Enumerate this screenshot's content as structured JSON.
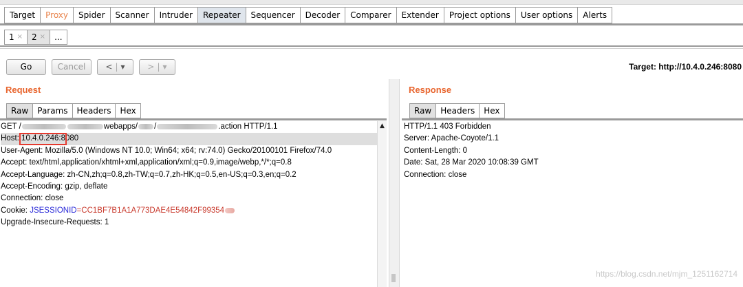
{
  "main_tabs": [
    {
      "label": "Target"
    },
    {
      "label": "Proxy"
    },
    {
      "label": "Spider"
    },
    {
      "label": "Scanner"
    },
    {
      "label": "Intruder"
    },
    {
      "label": "Repeater"
    },
    {
      "label": "Sequencer"
    },
    {
      "label": "Decoder"
    },
    {
      "label": "Comparer"
    },
    {
      "label": "Extender"
    },
    {
      "label": "Project options"
    },
    {
      "label": "User options"
    },
    {
      "label": "Alerts"
    }
  ],
  "active_main_tab": "Repeater",
  "sub_tabs": [
    {
      "label": "1",
      "close": "×"
    },
    {
      "label": "2",
      "close": "×"
    },
    {
      "label": "..."
    }
  ],
  "toolbar": {
    "go_label": "Go",
    "cancel_label": "Cancel",
    "back_label": "<",
    "forward_label": ">",
    "dropdown_glyph": "▾",
    "target_text": "Target: http://10.4.0.246:8080"
  },
  "request": {
    "title": "Request",
    "tabs": [
      "Raw",
      "Params",
      "Headers",
      "Hex"
    ],
    "active_tab": "Raw",
    "line_get_prefix": "GET /",
    "line_get_mid1": "webapps/",
    "line_get_mid2": "/",
    "line_get_suffix": ".action HTTP/1.1",
    "host_label": "Host: ",
    "host_ip": "10.4.0.246",
    "host_port": ":8080",
    "lines": [
      "User-Agent: Mozilla/5.0 (Windows NT 10.0; Win64; x64; rv:74.0) Gecko/20100101 Firefox/74.0",
      "Accept: text/html,application/xhtml+xml,application/xml;q=0.9,image/webp,*/*;q=0.8",
      "Accept-Language: zh-CN,zh;q=0.8,zh-TW;q=0.7,zh-HK;q=0.5,en-US;q=0.3,en;q=0.2",
      "Accept-Encoding: gzip, deflate",
      "Connection: close"
    ],
    "cookie_label": "Cookie: ",
    "cookie_name": "JSESSIONID",
    "cookie_eq": "=",
    "cookie_value": "CC1BF7B1A1A773DAE4E54842F99354",
    "last_line": "Upgrade-Insecure-Requests: 1"
  },
  "response": {
    "title": "Response",
    "tabs": [
      "Raw",
      "Headers",
      "Hex"
    ],
    "active_tab": "Raw",
    "lines": [
      "HTTP/1.1 403 Forbidden",
      "Server: Apache-Coyote/1.1",
      "Content-Length: 0",
      "Date: Sat, 28 Mar 2020 10:08:39 GMT",
      "Connection: close"
    ]
  },
  "watermark": "https://blog.csdn.net/mjm_1251162714",
  "colors": {
    "section_title": "#e8652e",
    "proxy_tab": "#e8824a",
    "cookie_name": "#2b2bd8",
    "cookie_value": "#c93b2e",
    "highlight_box": "#e53a2f"
  }
}
